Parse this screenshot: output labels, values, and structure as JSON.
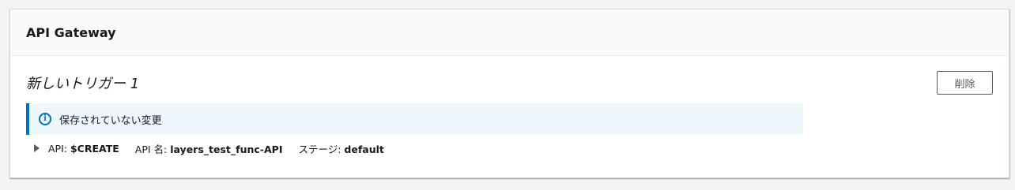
{
  "panel": {
    "title": "API Gateway"
  },
  "trigger": {
    "name": "新しいトリガー 1",
    "delete_label": "削除"
  },
  "alert": {
    "icon": "info-icon",
    "message": "保存されていない変更",
    "accent_color": "#0073bb",
    "background_color": "#eef8fc"
  },
  "details": {
    "expand_icon": "caret-right-icon",
    "api_label": "API: ",
    "api_value": "$CREATE",
    "api_name_label": "API 名: ",
    "api_name_value": "layers_test_func-API",
    "stage_label": "ステージ: ",
    "stage_value": "default"
  }
}
